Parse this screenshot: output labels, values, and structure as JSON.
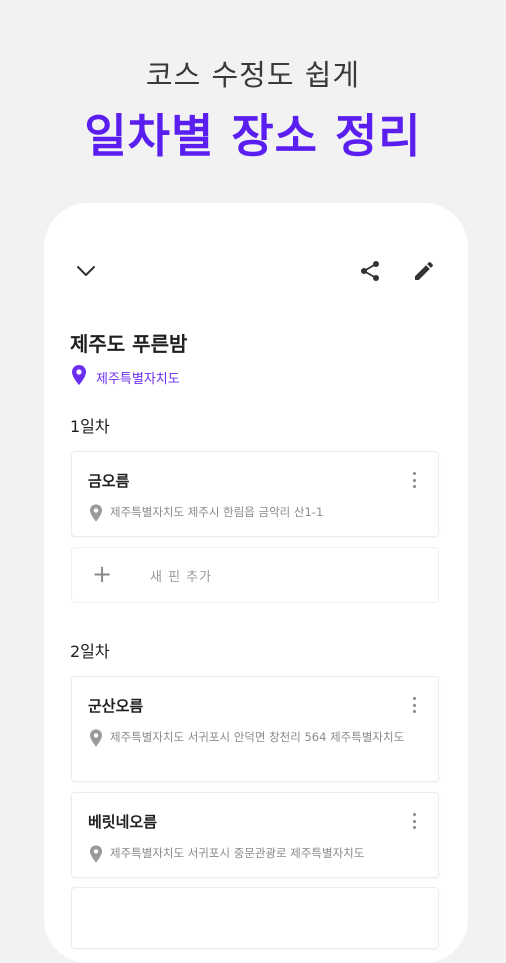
{
  "hero": {
    "subtitle": "코스 수정도 쉽게",
    "title": "일차별 장소 정리"
  },
  "colors": {
    "accent": "#5a1ff0",
    "region": "#6a2ff0",
    "background": "#f2f2f2"
  },
  "course": {
    "title": "제주도 푸른밤",
    "region": "제주특별자치도"
  },
  "days": [
    {
      "label": "1일차",
      "places": [
        {
          "name": "금오름",
          "address": "제주특별자치도 제주시 한림읍 금악리 산1-1"
        }
      ],
      "add_pin_label": "새 핀 추가"
    },
    {
      "label": "2일차",
      "places": [
        {
          "name": "군산오름",
          "address": "제주특별자치도 서귀포시 안덕면 창천리 564 제주특별자치도"
        },
        {
          "name": "베릿네오름",
          "address": "제주특별자치도 서귀포시 중문관광로 제주특별자치도"
        }
      ]
    }
  ],
  "icons": {
    "collapse": "chevron-down-icon",
    "share": "share-icon",
    "edit": "pencil-icon",
    "location": "location-pin-icon",
    "more": "more-vertical-icon",
    "add": "plus-icon"
  }
}
